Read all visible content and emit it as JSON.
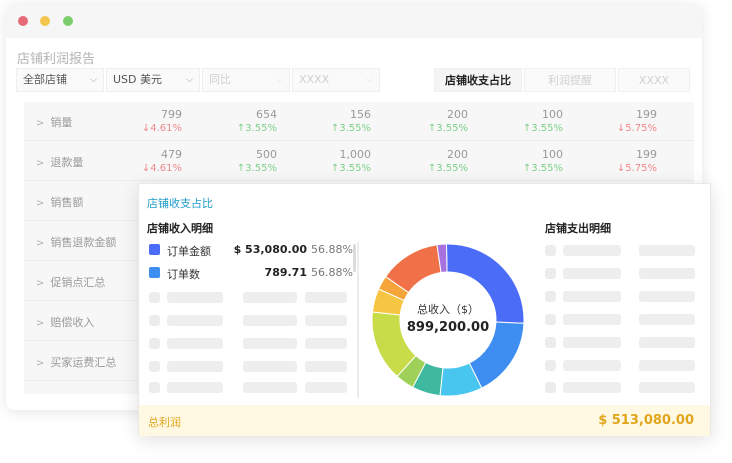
{
  "report": {
    "title": "店铺利润报告",
    "filters": {
      "store": "全部店铺",
      "currency": "USD 美元",
      "compare": "同比",
      "extra": "XXXX"
    },
    "tabs": [
      {
        "label": "店铺收支占比",
        "active": true
      },
      {
        "label": "利润提醒",
        "active": false
      },
      {
        "label": "XXXX",
        "active": false
      }
    ],
    "rows": [
      {
        "label": "销量",
        "cells": [
          {
            "value": "799",
            "change": "↓4.61%",
            "dir": "down"
          },
          {
            "value": "654",
            "change": "↑3.55%",
            "dir": "up"
          },
          {
            "value": "156",
            "change": "↑3.55%",
            "dir": "up"
          },
          {
            "value": "200",
            "change": "↑3.55%",
            "dir": "up"
          },
          {
            "value": "100",
            "change": "↑3.55%",
            "dir": "up"
          },
          {
            "value": "199",
            "change": "↓5.75%",
            "dir": "down"
          }
        ]
      },
      {
        "label": "退款量",
        "cells": [
          {
            "value": "479",
            "change": "↓4.61%",
            "dir": "down"
          },
          {
            "value": "500",
            "change": "↑3.55%",
            "dir": "up"
          },
          {
            "value": "1,000",
            "change": "↑3.55%",
            "dir": "up"
          },
          {
            "value": "200",
            "change": "↑3.55%",
            "dir": "up"
          },
          {
            "value": "100",
            "change": "↑3.55%",
            "dir": "up"
          },
          {
            "value": "199",
            "change": "↓5.75%",
            "dir": "down"
          }
        ]
      },
      {
        "label": "销售额",
        "cells": []
      },
      {
        "label": "销售退款金额",
        "cells": []
      },
      {
        "label": "促销点汇总",
        "cells": []
      },
      {
        "label": "赔偿收入",
        "cells": []
      },
      {
        "label": "买家运费汇总",
        "cells": []
      }
    ]
  },
  "panel": {
    "title": "店铺收支占比",
    "income_title": "店铺收入明细",
    "expense_title": "店铺支出明细",
    "income_items": [
      {
        "name": "订单金额",
        "amount": "$ 53,080.00",
        "percent": "56.88%",
        "color": "#4a6cf7"
      },
      {
        "name": "订单数",
        "amount": "789.71",
        "percent": "56.88%",
        "color": "#3d8ef0"
      }
    ],
    "donut": {
      "center_label": "总收入（$）",
      "center_value": "899,200.00",
      "segments": [
        {
          "color": "#4a6cf7",
          "value": 26
        },
        {
          "color": "#3d8ef0",
          "value": 17
        },
        {
          "color": "#48c6f0",
          "value": 9
        },
        {
          "color": "#3fb8a0",
          "value": 6
        },
        {
          "color": "#9fd15a",
          "value": 4
        },
        {
          "color": "#c8dc4a",
          "value": 15
        },
        {
          "color": "#f6c643",
          "value": 5
        },
        {
          "color": "#f5a53a",
          "value": 3
        },
        {
          "color": "#f07048",
          "value": 13
        },
        {
          "color": "#a772e0",
          "value": 2
        }
      ]
    },
    "footer": {
      "label": "总利润",
      "value": "$ 513,080.00"
    }
  },
  "icons": {
    "row_expand": "chevron-right-icon",
    "select": "chevron-down-icon"
  }
}
